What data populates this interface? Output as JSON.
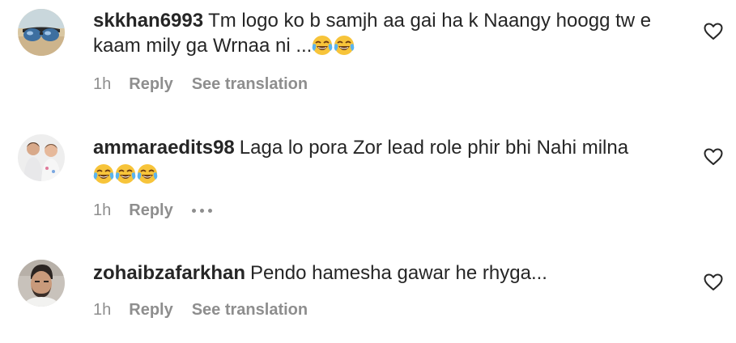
{
  "comments": [
    {
      "username": "skkhan6993",
      "text": "Tm logo ko b samjh aa gai ha k Naangy hoogg tw e kaam mily ga Wrnaa ni ...",
      "emojis": [
        "face-with-tears-of-joy",
        "face-with-tears-of-joy"
      ],
      "time": "1h",
      "reply_label": "Reply",
      "translate_label": "See translation",
      "avatar_icon": "sunglasses-avatar"
    },
    {
      "username": "ammaraedits98",
      "text": "Laga lo pora Zor lead role phir bhi Nahi milna",
      "emojis": [
        "face-with-tears-of-joy",
        "face-with-tears-of-joy",
        "face-with-tears-of-joy"
      ],
      "time": "1h",
      "reply_label": "Reply",
      "more_icon": "more-options-icon",
      "avatar_icon": "kids-photo-avatar"
    },
    {
      "username": "zohaibzafarkhan",
      "text": "Pendo hamesha gawar he rhyga...",
      "time": "1h",
      "reply_label": "Reply",
      "translate_label": "See translation",
      "avatar_icon": "man-photo-avatar"
    }
  ],
  "like_icon": "heart-outline-icon",
  "colors": {
    "primary_text": "#262626",
    "secondary_text": "#8e8e8e",
    "background": "#ffffff"
  }
}
